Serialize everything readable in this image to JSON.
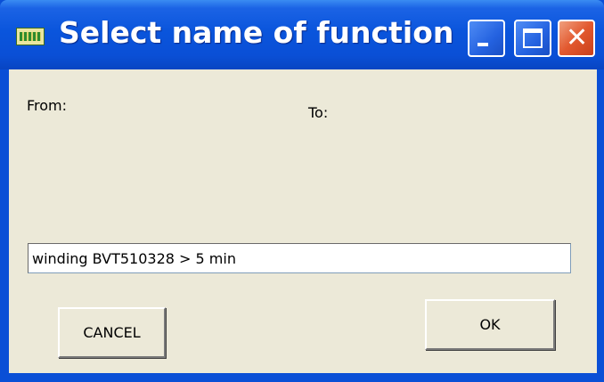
{
  "window": {
    "title": "Select name of function",
    "app_icon": "app-icon",
    "controls": {
      "minimize_icon": "minimize-icon",
      "maximize_icon": "maximize-icon",
      "close_icon": "close-icon",
      "close_glyph": "✕"
    }
  },
  "form": {
    "from_label": "From:",
    "to_label": "To:",
    "function_name_value": "winding BVT510328 > 5 min"
  },
  "buttons": {
    "cancel_label": "CANCEL",
    "ok_label": "OK"
  },
  "colors": {
    "titlebar": "#0a4fd6",
    "dialog_bg": "#ece9d8",
    "close_button": "#e2592f"
  }
}
